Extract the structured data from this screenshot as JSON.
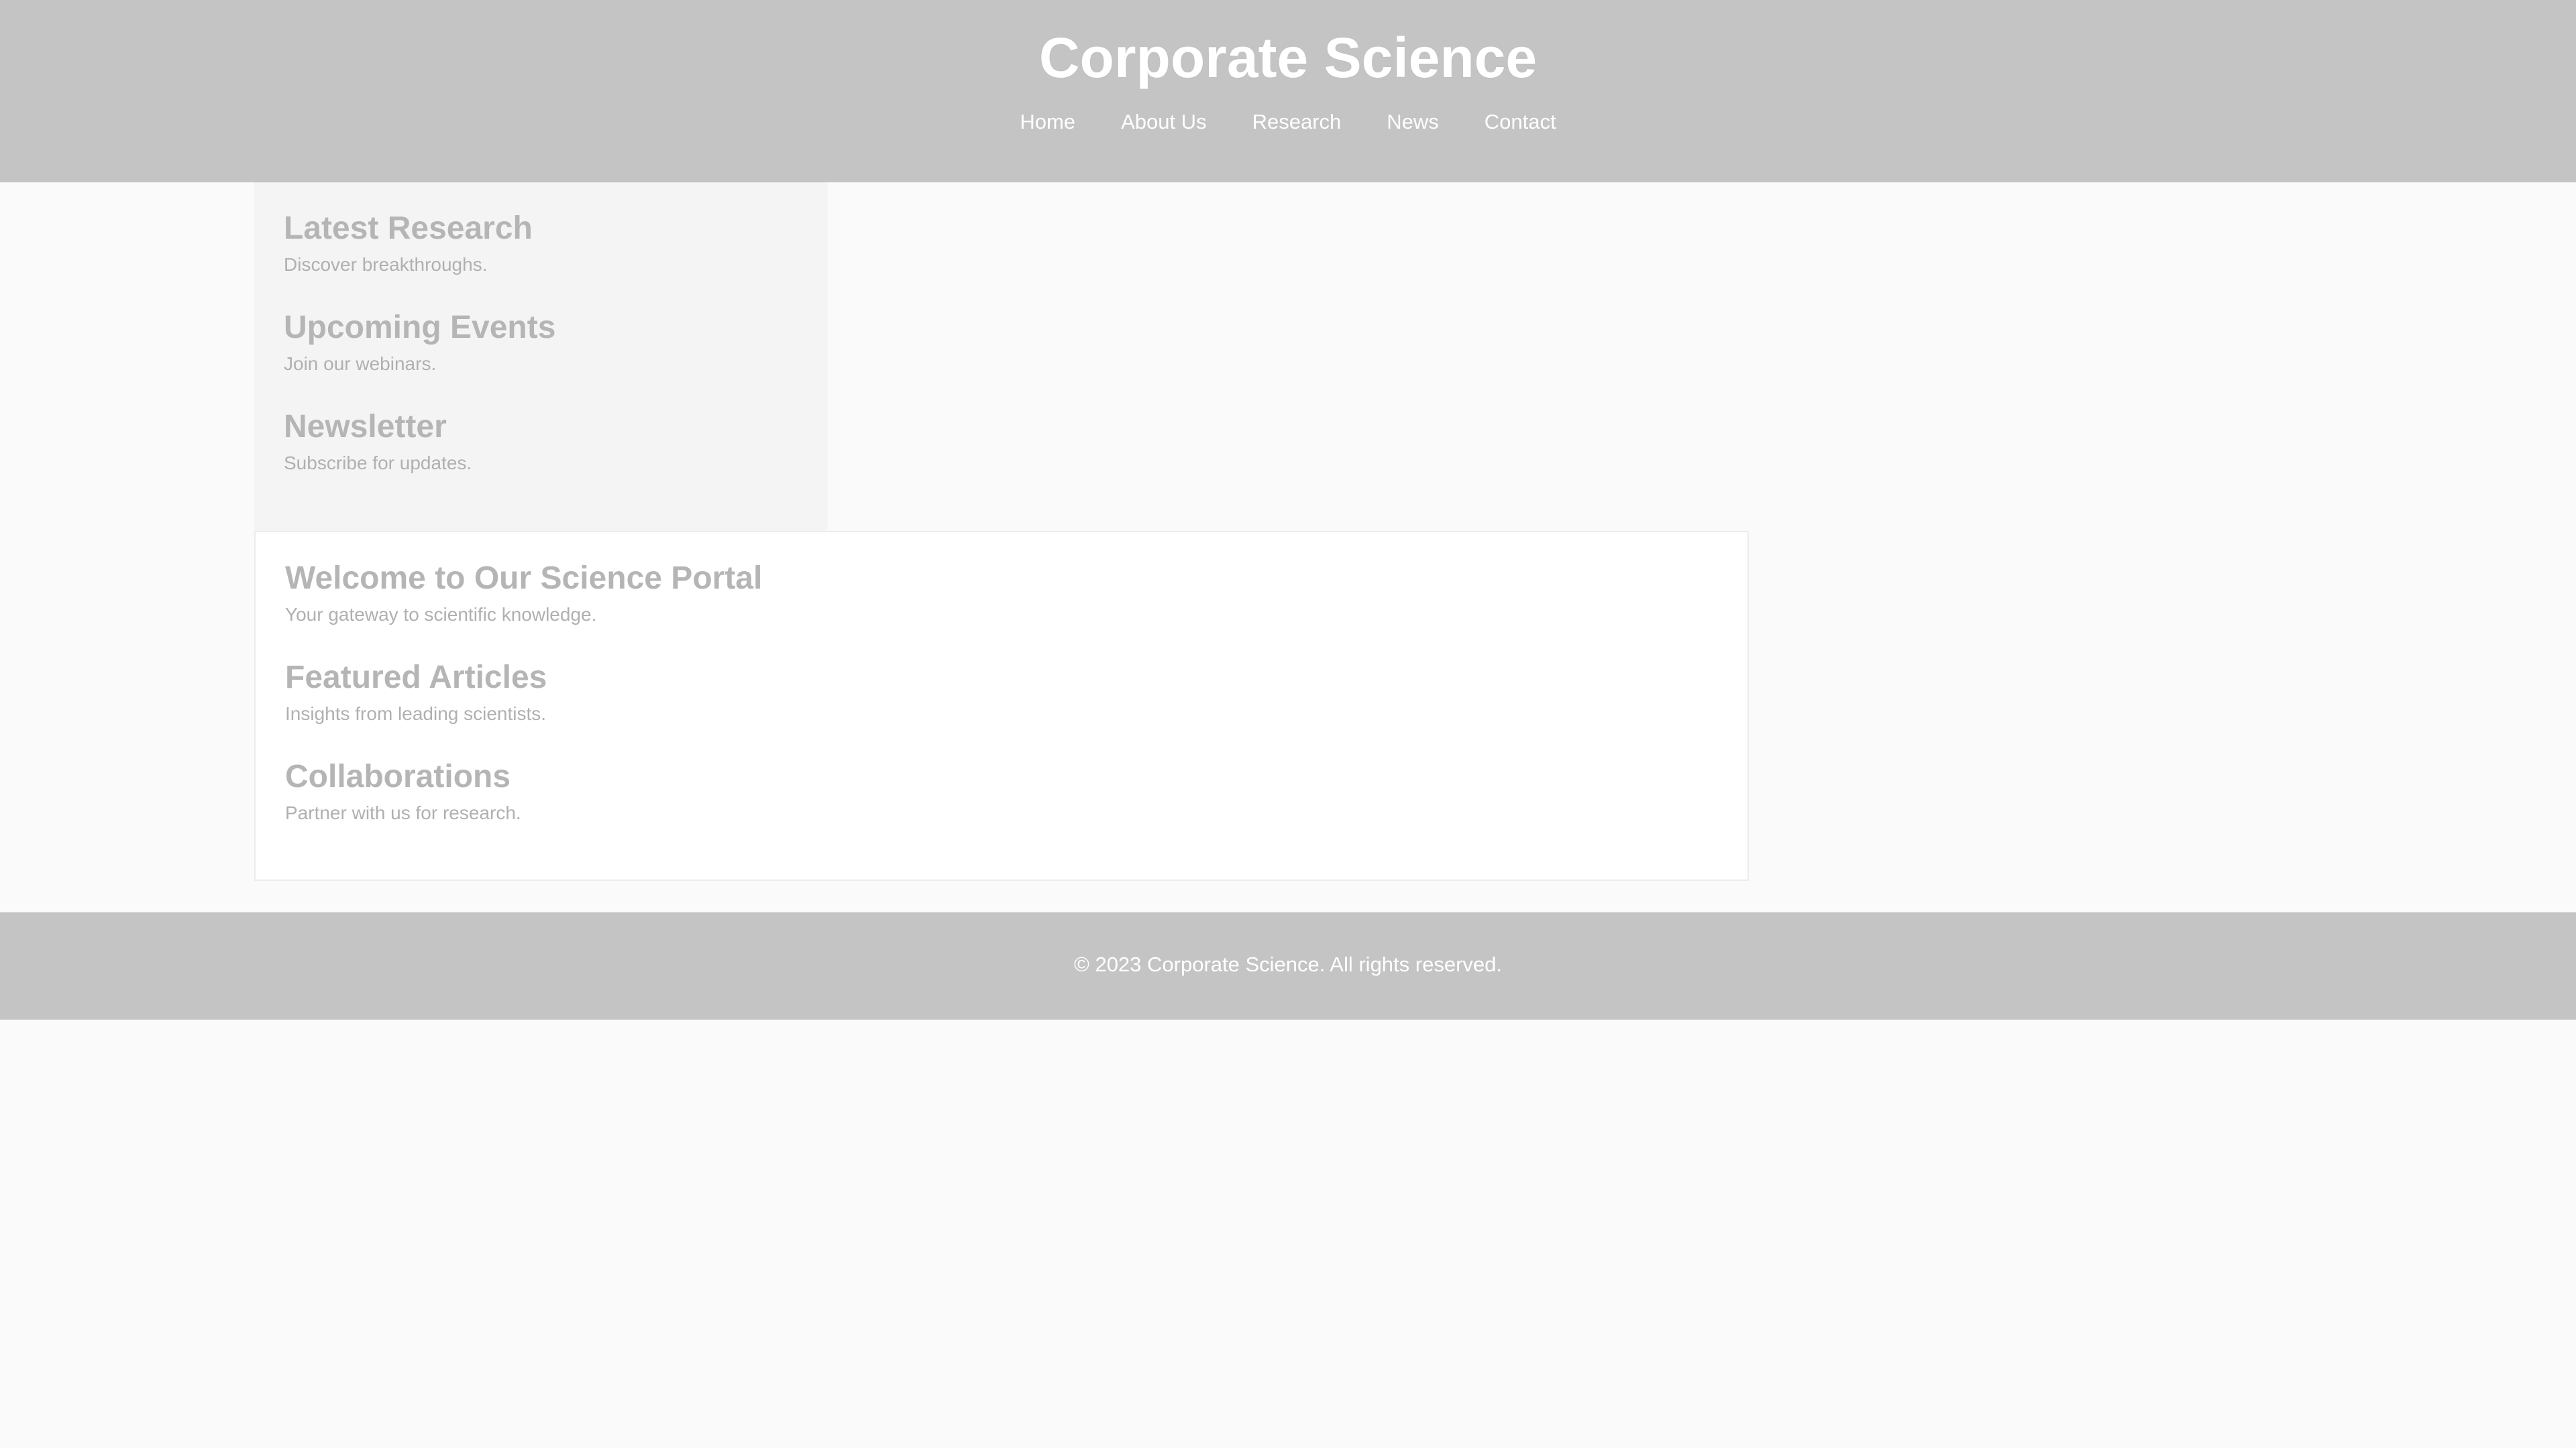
{
  "header": {
    "title": "Corporate Science",
    "nav": [
      "Home",
      "About Us",
      "Research",
      "News",
      "Contact"
    ]
  },
  "sidebar": {
    "sections": [
      {
        "title": "Latest Research",
        "text": "Discover breakthroughs."
      },
      {
        "title": "Upcoming Events",
        "text": "Join our webinars."
      },
      {
        "title": "Newsletter",
        "text": "Subscribe for updates."
      }
    ]
  },
  "main": {
    "sections": [
      {
        "title": "Welcome to Our Science Portal",
        "text": "Your gateway to scientific knowledge."
      },
      {
        "title": "Featured Articles",
        "text": "Insights from leading scientists."
      },
      {
        "title": "Collaborations",
        "text": "Partner with us for research."
      }
    ]
  },
  "footer": {
    "text": "© 2023 Corporate Science. All rights reserved."
  },
  "colors": {
    "header_bg": "#c4c4c4",
    "page_bg": "#fafafa",
    "sidebar_bg": "#f4f4f4",
    "heading": "#b5b5b5",
    "body_text": "#b0b0b0"
  }
}
